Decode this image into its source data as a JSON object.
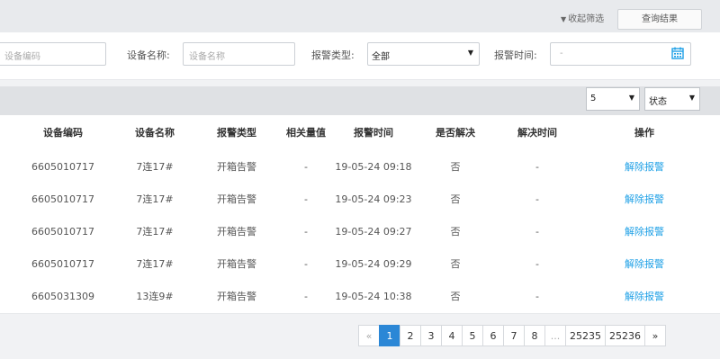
{
  "topbar": {
    "collapse_label": "收起筛选",
    "results_button": "查询结果"
  },
  "filters": {
    "device_code_placeholder": "设备编码",
    "device_name_label": "设备名称:",
    "device_name_placeholder": "设备名称",
    "alarm_type_label": "报警类型:",
    "alarm_type_value": "全部",
    "alarm_time_label": "报警时间:",
    "alarm_time_placeholder": "-"
  },
  "table_controls": {
    "page_size": "5",
    "status": "状态"
  },
  "table": {
    "columns": [
      "设备编码",
      "设备名称",
      "报警类型",
      "相关量值",
      "报警时间",
      "是否解决",
      "解决时间",
      "操作"
    ],
    "rows": [
      {
        "code": "6605010717",
        "name": "7连17#",
        "type": "开箱告警",
        "value": "-",
        "time": "19-05-24 09:18",
        "resolved": "否",
        "resolve_time": "-",
        "action": "解除报警"
      },
      {
        "code": "6605010717",
        "name": "7连17#",
        "type": "开箱告警",
        "value": "-",
        "time": "19-05-24 09:23",
        "resolved": "否",
        "resolve_time": "-",
        "action": "解除报警"
      },
      {
        "code": "6605010717",
        "name": "7连17#",
        "type": "开箱告警",
        "value": "-",
        "time": "19-05-24 09:27",
        "resolved": "否",
        "resolve_time": "-",
        "action": "解除报警"
      },
      {
        "code": "6605010717",
        "name": "7连17#",
        "type": "开箱告警",
        "value": "-",
        "time": "19-05-24 09:29",
        "resolved": "否",
        "resolve_time": "-",
        "action": "解除报警"
      },
      {
        "code": "6605031309",
        "name": "13连9#",
        "type": "开箱告警",
        "value": "-",
        "time": "19-05-24 10:38",
        "resolved": "否",
        "resolve_time": "-",
        "action": "解除报警"
      }
    ]
  },
  "pagination": {
    "prev": "«",
    "pages": [
      "1",
      "2",
      "3",
      "4",
      "5",
      "6",
      "7",
      "8",
      "...",
      "25235",
      "25236"
    ],
    "current": "1",
    "next": "»"
  }
}
